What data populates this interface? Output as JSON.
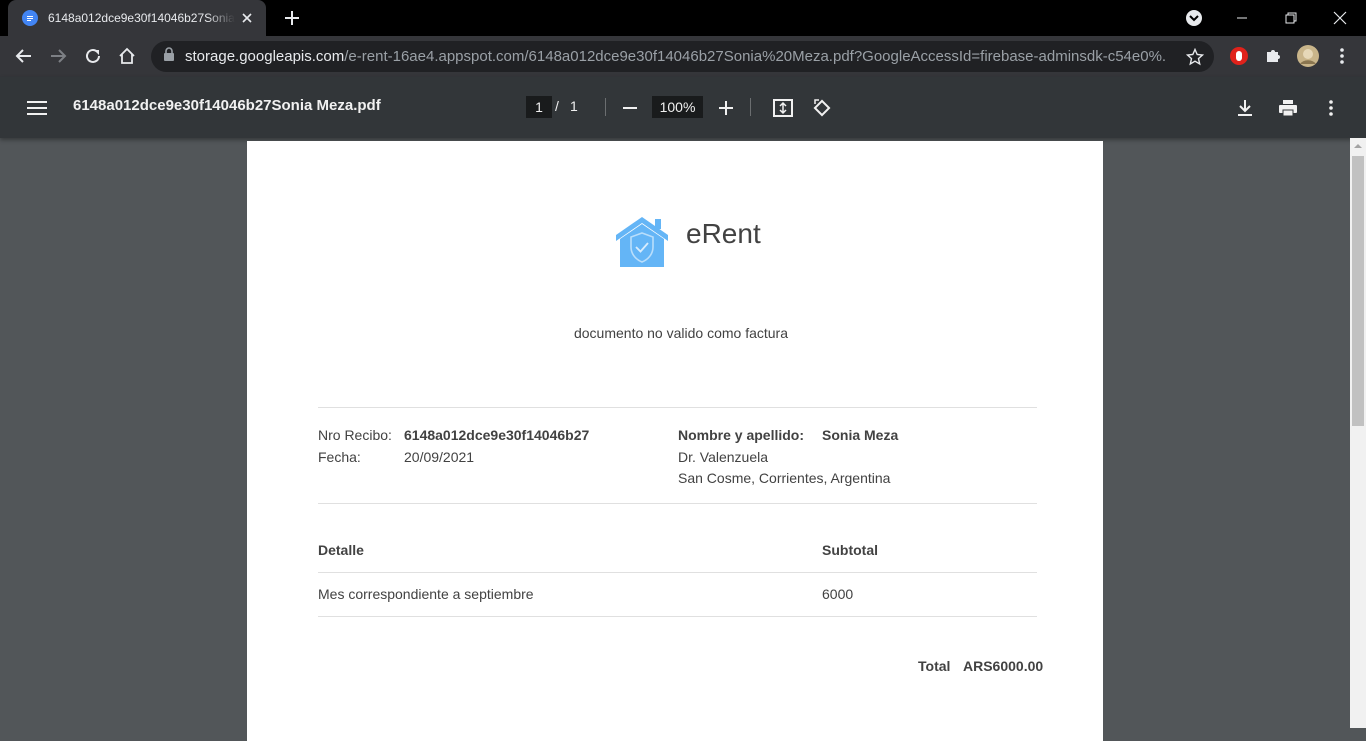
{
  "browser": {
    "tab_title": "6148a012dce9e30f14046b27Sonia Meza.pdf",
    "url_host": "storage.googleapis.com",
    "url_path": "/e-rent-16ae4.appspot.com/6148a012dce9e30f14046b27Sonia%20Meza.pdf?GoogleAccessId=firebase-adminsdk-c54e0%..."
  },
  "pdf": {
    "file_name": "6148a012dce9e30f14046b27Sonia Meza.pdf",
    "current_page": "1",
    "page_sep": "/",
    "total_pages": "1",
    "zoom": "100%"
  },
  "receipt": {
    "brand": "eRent",
    "disclaimer": "documento no valido como factura",
    "nro_label": "Nro Recibo:",
    "nro_value": "6148a012dce9e30f14046b27",
    "fecha_label": "Fecha:",
    "fecha_value": "20/09/2021",
    "name_label": "Nombre y apellido:",
    "name_value": "Sonia Meza",
    "address_line1": "Dr. Valenzuela",
    "address_line2": "San Cosme, Corrientes, Argentina",
    "col_detail": "Detalle",
    "col_subtotal": "Subtotal",
    "items": [
      {
        "detail": "Mes correspondiente a septiembre",
        "subtotal": "6000"
      }
    ],
    "total_label": "Total",
    "total_value": "ARS6000.00"
  },
  "colors": {
    "logo_blue": "#64b5f6",
    "pdf_toolbar": "#323639",
    "viewer_bg": "#525659"
  }
}
